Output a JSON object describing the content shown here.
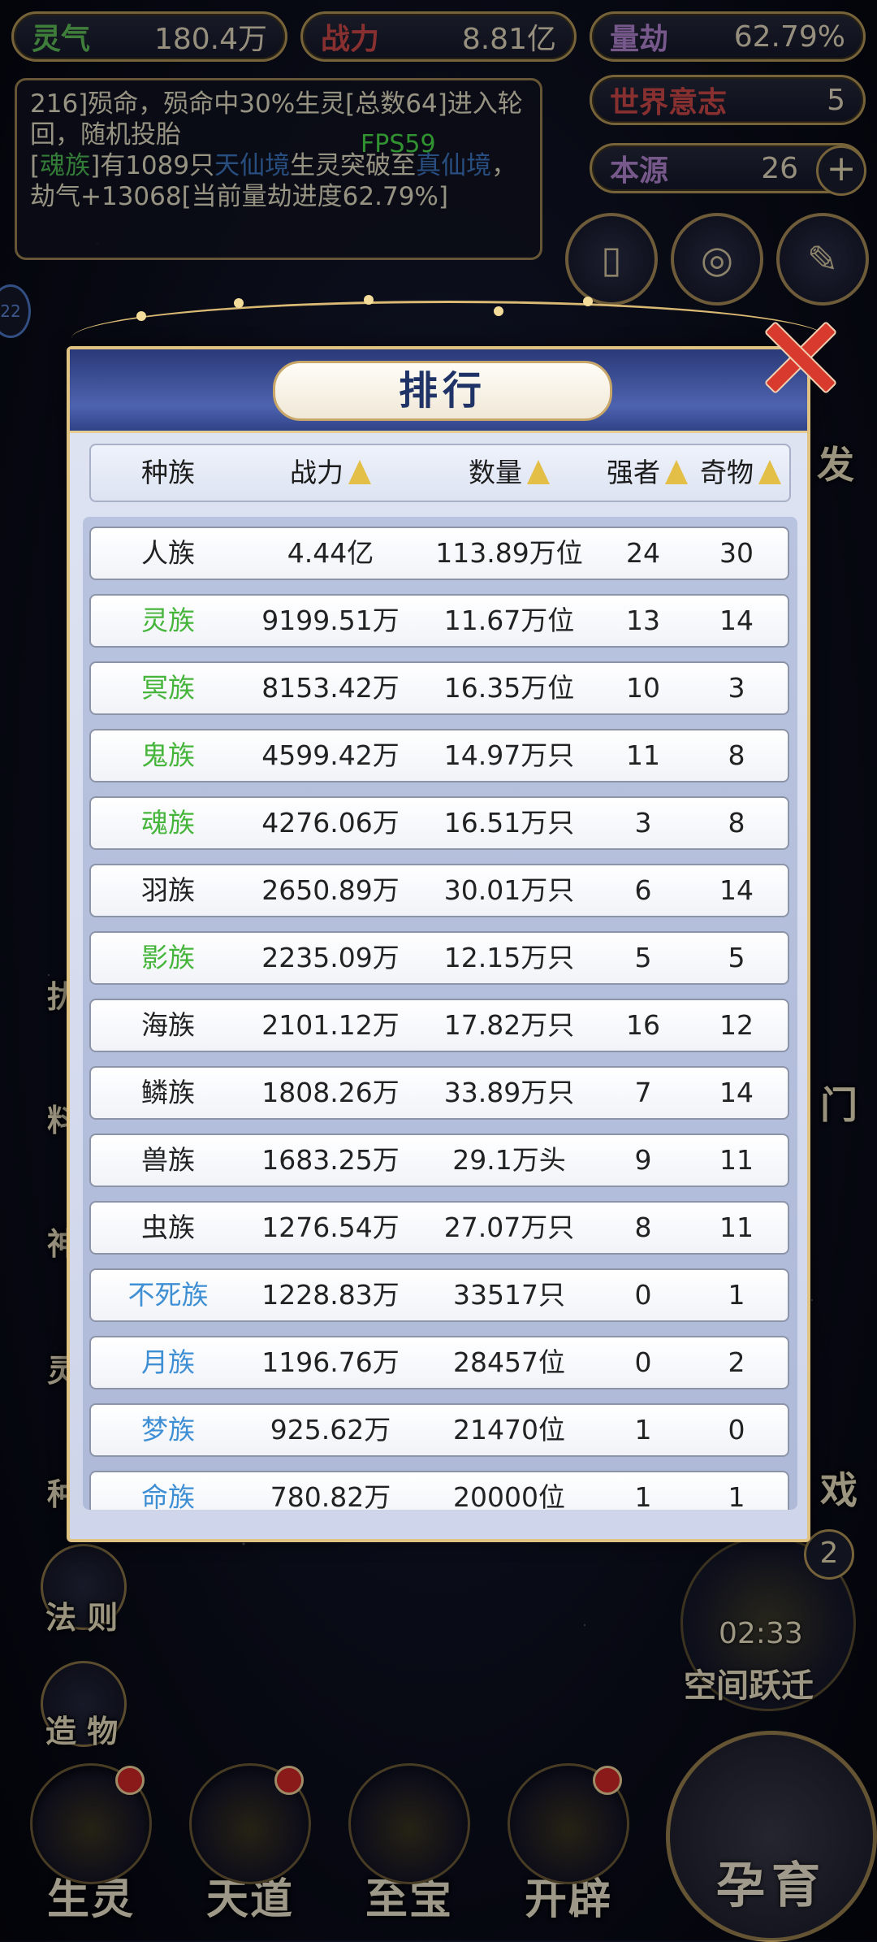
{
  "top_stats": {
    "lingqi": {
      "label": "灵气",
      "value": "180.4万"
    },
    "zhanli": {
      "label": "战力",
      "value": "8.81亿"
    },
    "liangjie": {
      "label": "量劫",
      "value": "62.79%"
    },
    "shijie_yizhi": {
      "label": "世界意志",
      "value": "5"
    },
    "benyuan": {
      "label": "本源",
      "value": "26",
      "plus": "+"
    }
  },
  "log": {
    "line1": "216]殒命，殒命中30%生灵[总数64]进入轮回，随机投胎",
    "line2_pre": "[",
    "race": "魂族",
    "line2_mid": "]有1089只",
    "realm1": "天仙境",
    "line2_mid2": "生灵突破至",
    "realm2": "真仙境",
    "line2_post": "，劫气+13068[当前量劫进度62.79%]"
  },
  "fps": "FPS59",
  "side_badge": "22",
  "side_partial_labels": {
    "right_a": "发",
    "right_b": "门",
    "right_c": "戏",
    "left_a": "扰",
    "left_b": "料",
    "left_c": "神",
    "left_d": "灵",
    "left_e": "种"
  },
  "left_buttons": {
    "fazhe": "法 则",
    "zaowu": "造 物"
  },
  "timer": {
    "count": "2",
    "time": "02:33",
    "label": "空间跃迁"
  },
  "bottom_nav": {
    "shengling": "生灵",
    "tiandao": "天道",
    "zhibao": "至宝",
    "kaipi": "开辟",
    "yunyu": "孕育"
  },
  "modal": {
    "title": "排行",
    "headers": {
      "race": "种族",
      "power": "战力",
      "count": "数量",
      "strong": "强者",
      "artifact": "奇物"
    },
    "rows": [
      {
        "race": "人族",
        "power": "4.44亿",
        "count": "113.89万位",
        "strong": "24",
        "artifact": "30",
        "color": "#222222"
      },
      {
        "race": "灵族",
        "power": "9199.51万",
        "count": "11.67万位",
        "strong": "13",
        "artifact": "14",
        "color": "#46b53b"
      },
      {
        "race": "冥族",
        "power": "8153.42万",
        "count": "16.35万位",
        "strong": "10",
        "artifact": "3",
        "color": "#46b53b"
      },
      {
        "race": "鬼族",
        "power": "4599.42万",
        "count": "14.97万只",
        "strong": "11",
        "artifact": "8",
        "color": "#46b53b"
      },
      {
        "race": "魂族",
        "power": "4276.06万",
        "count": "16.51万只",
        "strong": "3",
        "artifact": "8",
        "color": "#46b53b"
      },
      {
        "race": "羽族",
        "power": "2650.89万",
        "count": "30.01万只",
        "strong": "6",
        "artifact": "14",
        "color": "#222222"
      },
      {
        "race": "影族",
        "power": "2235.09万",
        "count": "12.15万只",
        "strong": "5",
        "artifact": "5",
        "color": "#46b53b"
      },
      {
        "race": "海族",
        "power": "2101.12万",
        "count": "17.82万只",
        "strong": "16",
        "artifact": "12",
        "color": "#222222"
      },
      {
        "race": "鳞族",
        "power": "1808.26万",
        "count": "33.89万只",
        "strong": "7",
        "artifact": "14",
        "color": "#222222"
      },
      {
        "race": "兽族",
        "power": "1683.25万",
        "count": "29.1万头",
        "strong": "9",
        "artifact": "11",
        "color": "#222222"
      },
      {
        "race": "虫族",
        "power": "1276.54万",
        "count": "27.07万只",
        "strong": "8",
        "artifact": "11",
        "color": "#222222"
      },
      {
        "race": "不死族",
        "power": "1228.83万",
        "count": "33517只",
        "strong": "0",
        "artifact": "1",
        "color": "#3f8fd4"
      },
      {
        "race": "月族",
        "power": "1196.76万",
        "count": "28457位",
        "strong": "0",
        "artifact": "2",
        "color": "#3f8fd4"
      },
      {
        "race": "梦族",
        "power": "925.62万",
        "count": "21470位",
        "strong": "1",
        "artifact": "0",
        "color": "#3f8fd4"
      },
      {
        "race": "命族",
        "power": "780.82万",
        "count": "20000位",
        "strong": "1",
        "artifact": "1",
        "color": "#3f8fd4"
      }
    ]
  }
}
